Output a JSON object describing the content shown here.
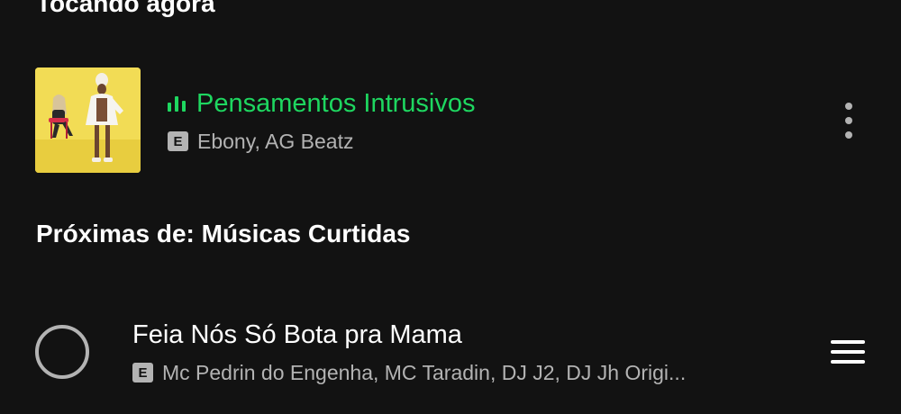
{
  "now_playing": {
    "section_title": "Tocando agora",
    "track": {
      "title": "Pensamentos Intrusivos",
      "explicit_badge": "E",
      "artists": "Ebony, AG Beatz",
      "icon": "equalizer-icon"
    },
    "more_icon": "more-vertical-icon"
  },
  "queue": {
    "section_title": "Próximas de: Músicas Curtidas",
    "items": [
      {
        "title": "Feia Nós Só Bota pra Mama",
        "explicit_badge": "E",
        "artists": "Mc Pedrin do Engenha, MC Taradin, DJ J2, DJ Jh Origi...",
        "select_icon": "circle-icon",
        "drag_icon": "drag-handle-icon"
      }
    ]
  },
  "colors": {
    "background": "#121212",
    "accent": "#1ed760",
    "secondary_text": "#b3b3b3",
    "cover_background": "#f2dc55"
  }
}
